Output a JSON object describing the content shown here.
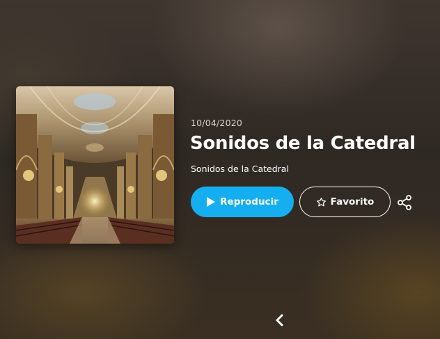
{
  "release": {
    "date": "10/04/2020",
    "title": "Sonidos de la Catedral",
    "subtitle": "Sonidos de la Catedral"
  },
  "actions": {
    "play_label": "Reproducir",
    "favorite_label": "Favorito"
  },
  "icons": {
    "play": "play-icon",
    "favorite": "star-outline-icon",
    "share": "share-icon",
    "back": "chevron-left-icon"
  },
  "colors": {
    "accent": "#15aef0",
    "text": "#ffffff",
    "muted_text": "#d9d2cb"
  }
}
